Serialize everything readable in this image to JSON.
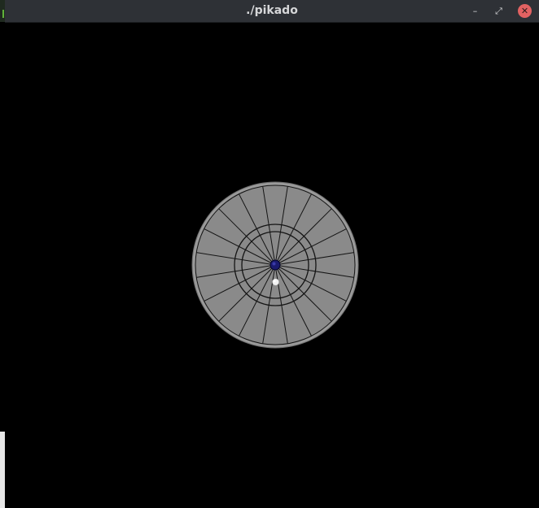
{
  "window": {
    "title": "./pikado",
    "controls": {
      "minimize_glyph": "–",
      "maximize_glyph": "⤢",
      "close_glyph": "✕"
    }
  },
  "scene": {
    "background_color": "#000000",
    "board_color": "#8a8a8a",
    "line_color": "#141414",
    "bull_color": "#1a1a6e",
    "dart_color": "#f2f2f2",
    "segment_count": 20
  }
}
